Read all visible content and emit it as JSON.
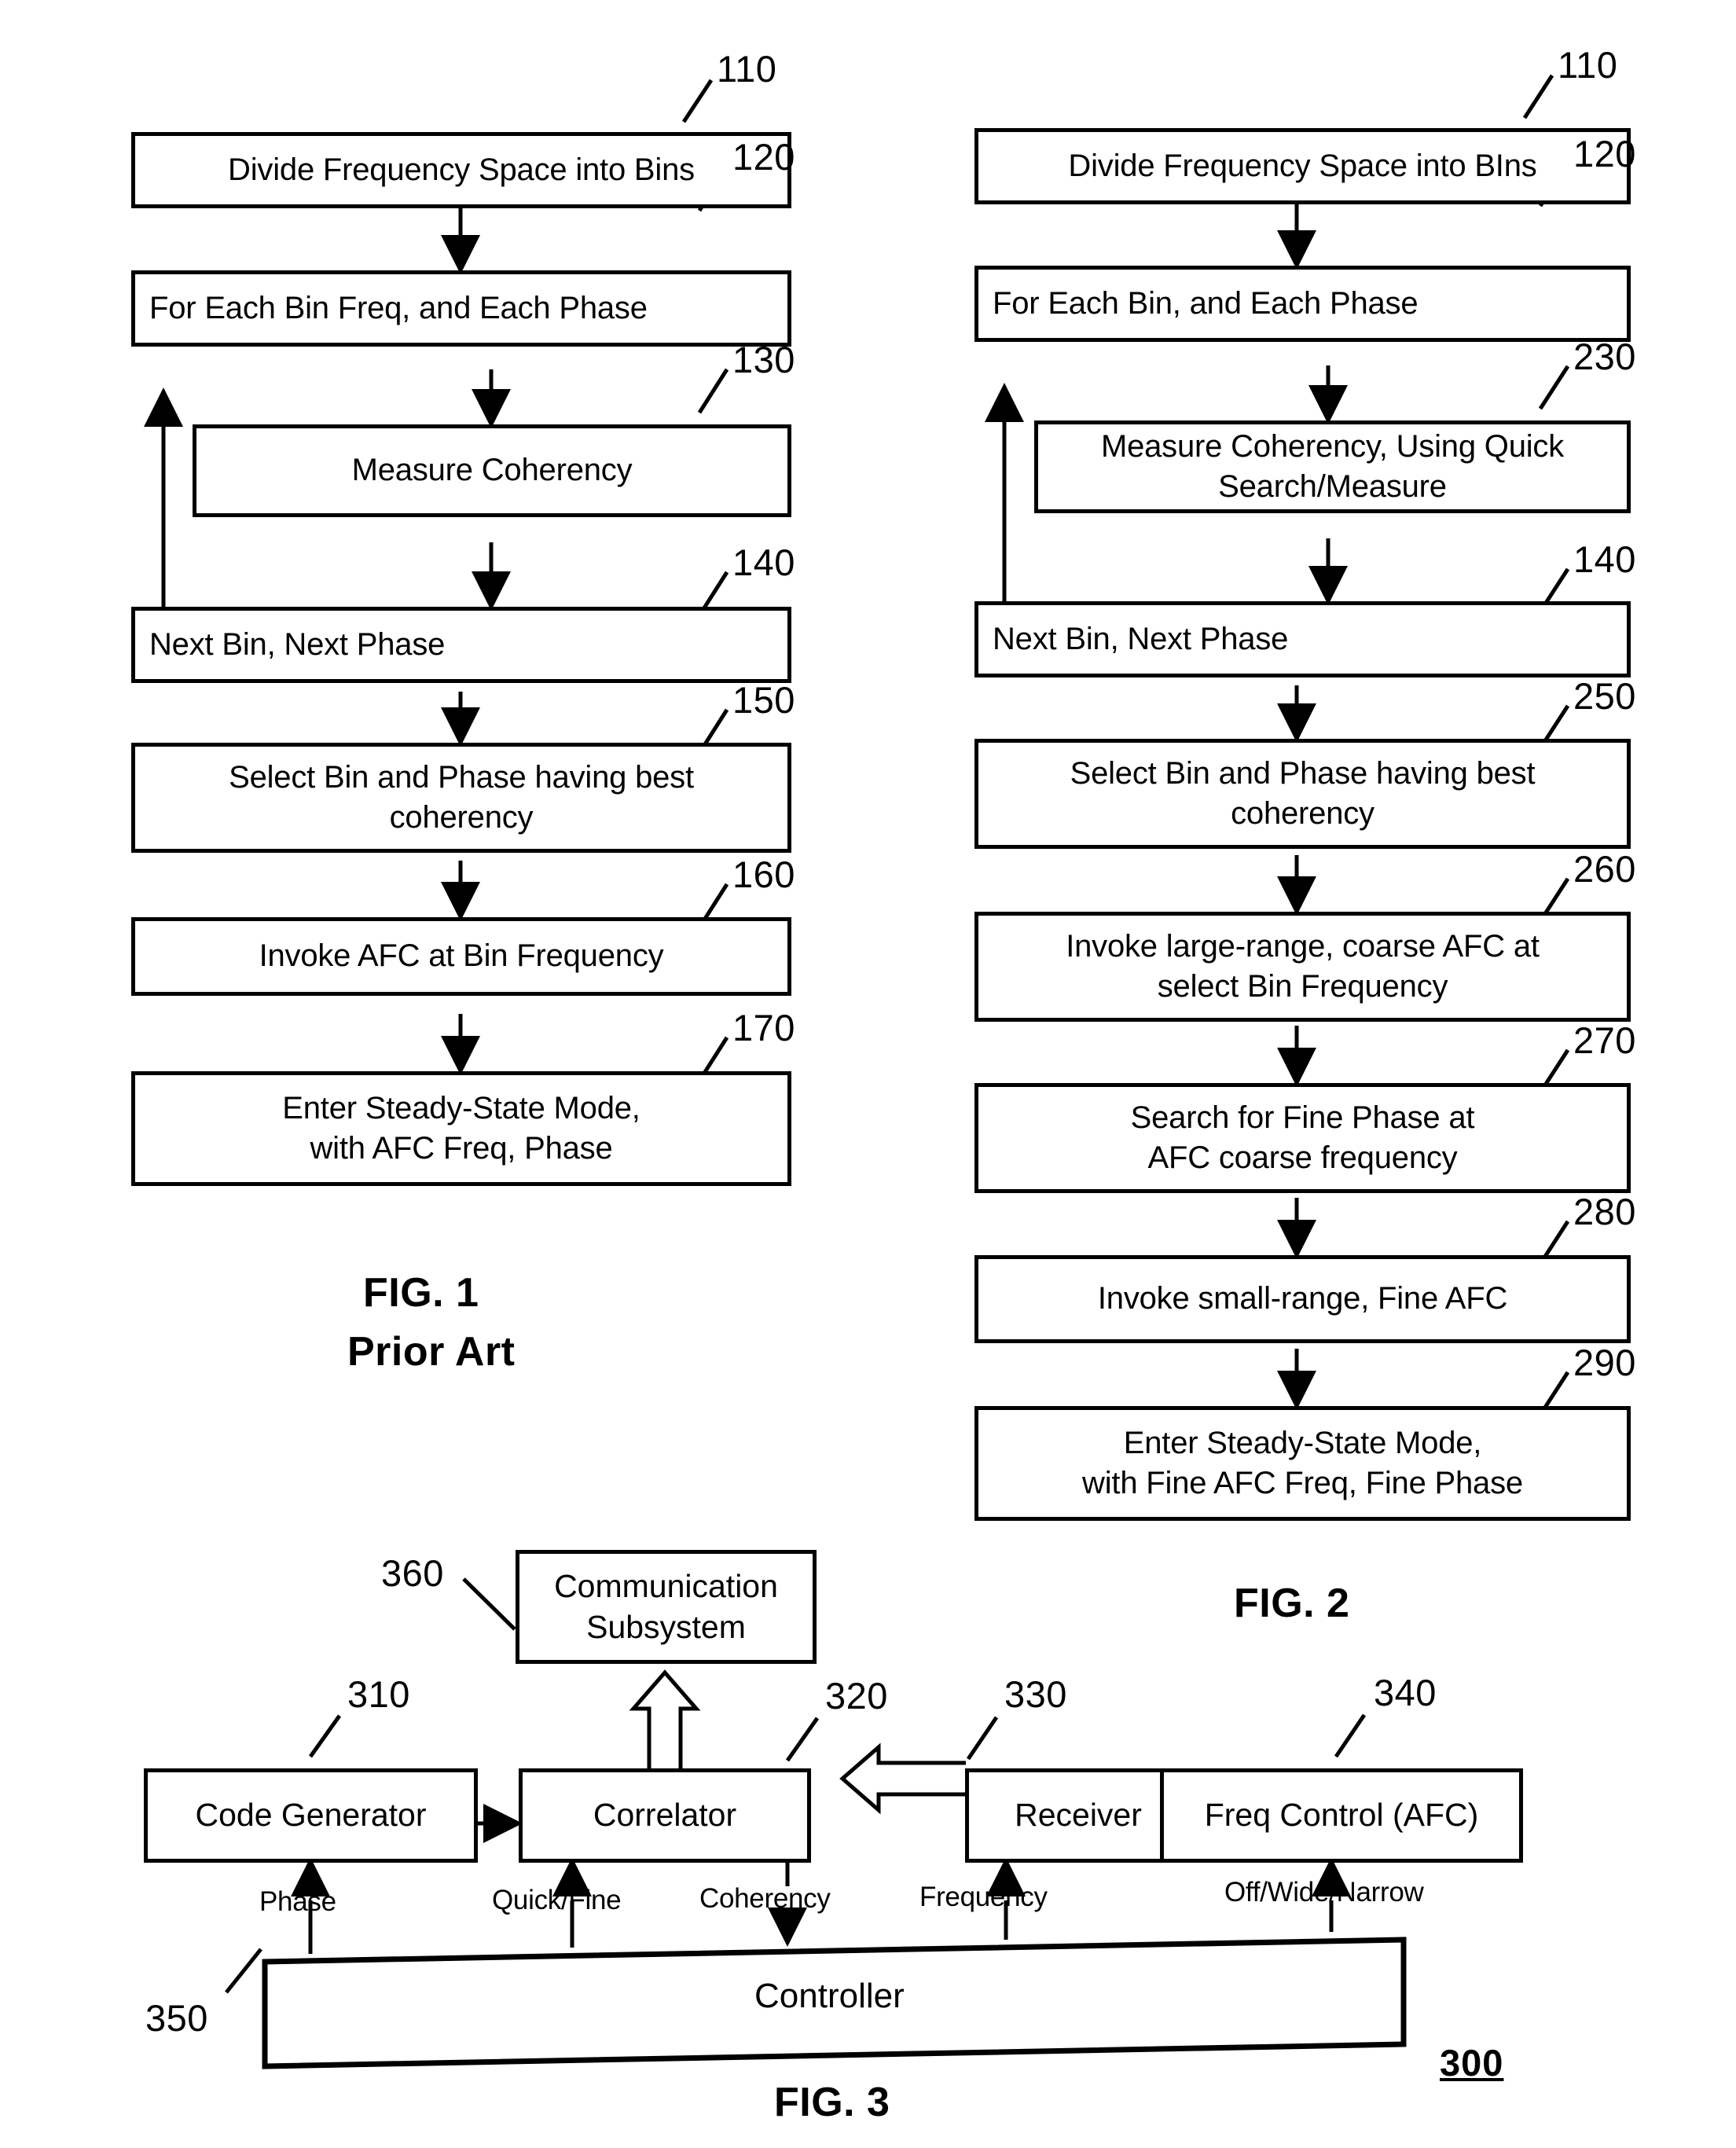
{
  "figure1": {
    "caption_line1": "FIG. 1",
    "caption_line2": "Prior Art",
    "steps": [
      {
        "ref": "110",
        "text": "Divide Frequency Space into Bins"
      },
      {
        "ref": "120",
        "text": "For Each Bin Freq, and Each Phase"
      },
      {
        "ref": "130",
        "text": "Measure Coherency"
      },
      {
        "ref": "140",
        "text": "Next Bin, Next Phase"
      },
      {
        "ref": "150",
        "text": "Select Bin and Phase having best coherency"
      },
      {
        "ref": "160",
        "text": "Invoke AFC at Bin Frequency"
      },
      {
        "ref": "170",
        "text": "Enter Steady-State Mode, with AFC Freq, Phase"
      }
    ],
    "step150_line1": "Select Bin and Phase having best",
    "step150_line2": "coherency",
    "step170_line1": "Enter Steady-State Mode,",
    "step170_line2": "with AFC Freq, Phase"
  },
  "figure2": {
    "caption": "FIG. 2",
    "steps": [
      {
        "ref": "110",
        "text": "Divide Frequency Space into BIns"
      },
      {
        "ref": "120",
        "text": "For Each Bin, and Each Phase"
      },
      {
        "ref": "230",
        "text": "Measure Coherency, Using Quick Search/Measure"
      },
      {
        "ref": "140",
        "text": "Next Bin, Next Phase"
      },
      {
        "ref": "250",
        "text": "Select Bin and Phase having best coherency"
      },
      {
        "ref": "260",
        "text": "Invoke large-range, coarse AFC at select Bin Frequency"
      },
      {
        "ref": "270",
        "text": "Search for Fine Phase at AFC coarse frequency"
      },
      {
        "ref": "280",
        "text": "Invoke small-range, Fine AFC"
      },
      {
        "ref": "290",
        "text": "Enter Steady-State Mode, with Fine AFC Freq, Fine Phase"
      }
    ],
    "step230_line1": "Measure Coherency, Using Quick",
    "step230_line2": "Search/Measure",
    "step250_line1": "Select Bin and Phase having best",
    "step250_line2": "coherency",
    "step260_line1": "Invoke large-range, coarse AFC at",
    "step260_line2": "select Bin Frequency",
    "step270_line1": "Search for Fine Phase at",
    "step270_line2": "AFC coarse frequency",
    "step290_line1": "Enter Steady-State Mode,",
    "step290_line2": "with Fine AFC Freq, Fine Phase"
  },
  "figure3": {
    "caption": "FIG. 3",
    "system_ref": "300",
    "blocks": [
      {
        "ref": "310",
        "label": "Code Generator"
      },
      {
        "ref": "320",
        "label": "Correlator"
      },
      {
        "ref": "330",
        "label": "Receiver"
      },
      {
        "ref": "340",
        "label": "Freq Control (AFC)"
      },
      {
        "ref": "350",
        "label": "Controller"
      },
      {
        "ref": "360",
        "label": "Communication Subsystem"
      }
    ],
    "comm_line1": "Communication",
    "comm_line2": "Subsystem",
    "signals": [
      {
        "name": "Phase"
      },
      {
        "name": "Quick/Fine"
      },
      {
        "name": "Coherency"
      },
      {
        "name": "Frequency"
      },
      {
        "name": "Off/Wide/Narrow"
      }
    ]
  }
}
